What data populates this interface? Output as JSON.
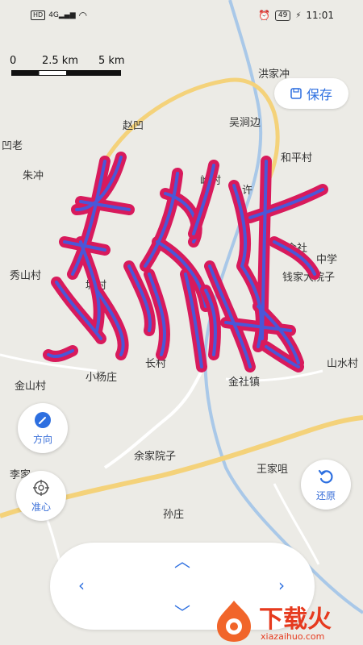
{
  "status_bar": {
    "network": "HD",
    "signal_text": "4G",
    "battery": "49",
    "time": "11:01"
  },
  "scale": {
    "labels": [
      "0",
      "2.5 km",
      "5 km"
    ]
  },
  "toolbar": {
    "save_label": "保存"
  },
  "map": {
    "places": [
      "洪家冲",
      "吴涧边",
      "赵凹",
      "和平村",
      "凹老",
      "朱冲",
      "秀山村",
      "金社",
      "钱家大院子",
      "塘村",
      "长村",
      "山水村",
      "金山村",
      "小杨庄",
      "金社镇",
      "余家院子",
      "王家咀",
      "李家",
      "孙庄",
      "中学",
      "许",
      "岭村"
    ]
  },
  "controls": {
    "direction_label": "方向",
    "center_label": "准心",
    "restore_label": "还原"
  },
  "watermark": {
    "main": "下载火",
    "sub": "xiazaihuo.com"
  },
  "colors": {
    "accent": "#2d6fe0",
    "drawing_outer": "#d81a5c",
    "drawing_inner": "#4a57d8"
  }
}
